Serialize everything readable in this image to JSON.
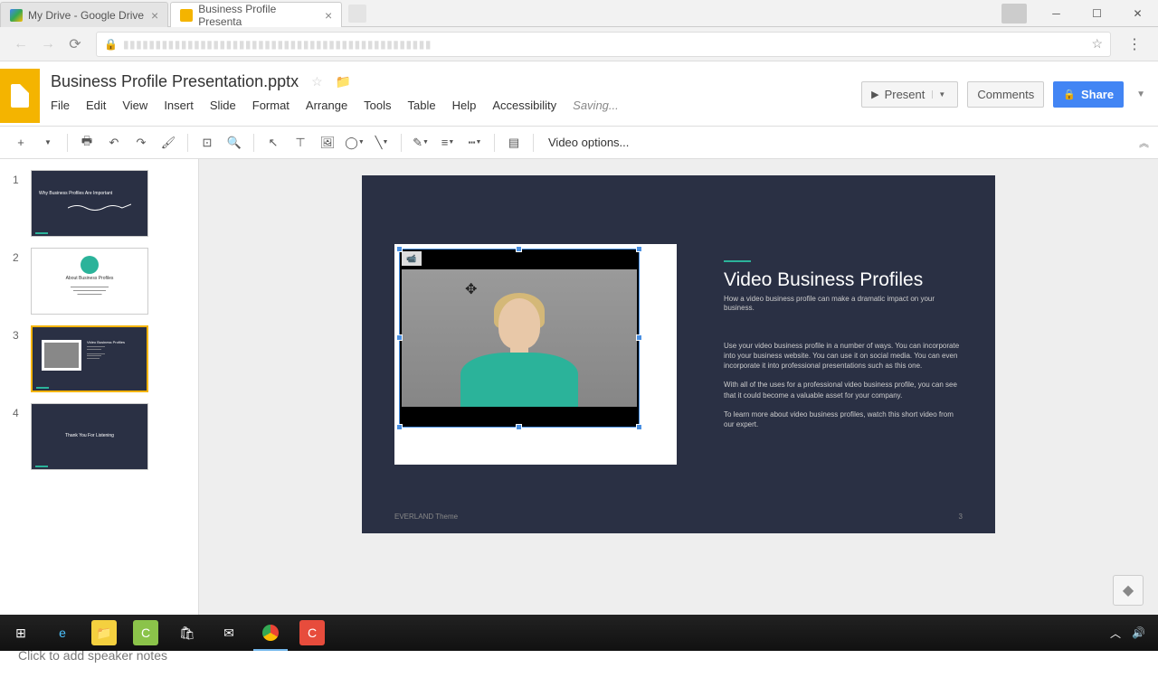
{
  "browser": {
    "tabs": [
      {
        "title": "My Drive - Google Drive"
      },
      {
        "title": "Business Profile Presenta"
      }
    ]
  },
  "doc": {
    "title": "Business Profile Presentation.pptx",
    "saving": "Saving..."
  },
  "menubar": {
    "file": "File",
    "edit": "Edit",
    "view": "View",
    "insert": "Insert",
    "slide": "Slide",
    "format": "Format",
    "arrange": "Arrange",
    "tools": "Tools",
    "table": "Table",
    "help": "Help",
    "accessibility": "Accessibility"
  },
  "header_actions": {
    "present": "Present",
    "comments": "Comments",
    "share": "Share"
  },
  "toolbar": {
    "video_options": "Video options..."
  },
  "thumbs": {
    "n1": "1",
    "n2": "2",
    "n3": "3",
    "n4": "4",
    "t1_title": "Why Business Profiles Are Important",
    "t2_title": "About Business Profiles",
    "t4_title": "Thank You For Listening"
  },
  "slide": {
    "title": "Video Business Profiles",
    "subtitle": "How a  video business profile can make a dramatic impact on your business.",
    "p1": "Use your video business profile in a number of ways. You can incorporate into your business website. You can use it on social media. You can even incorporate it into professional presentations such as this one.",
    "p2": "With all of the uses for a professional video business profile, you can see that it could become a valuable asset for your company.",
    "p3": "To learn more about video business profiles, watch this short video from our expert.",
    "footer": "EVERLAND Theme",
    "pagenum": "3"
  },
  "notes": {
    "placeholder": "Click to add speaker notes"
  },
  "colors": {
    "slide_bg": "#2a3044",
    "accent": "#2bb39a",
    "brand_yellow": "#f4b400",
    "share_blue": "#4285f4",
    "selection_blue": "#4a90e2"
  }
}
